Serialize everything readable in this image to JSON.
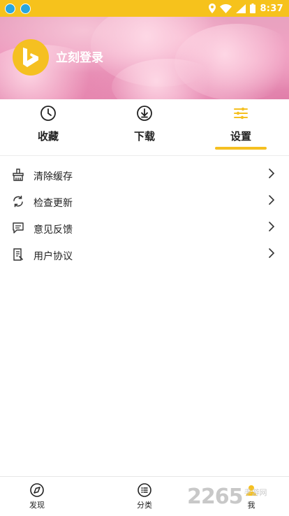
{
  "status_bar": {
    "time": "8:37"
  },
  "header": {
    "login_label": "立刻登录"
  },
  "tabs": [
    {
      "label": "收藏",
      "icon": "clock-icon"
    },
    {
      "label": "下载",
      "icon": "download-icon"
    },
    {
      "label": "设置",
      "icon": "settings-sliders-icon",
      "active": true
    }
  ],
  "menu": [
    {
      "label": "清除缓存",
      "icon": "broom-icon"
    },
    {
      "label": "检查更新",
      "icon": "refresh-icon"
    },
    {
      "label": "意见反馈",
      "icon": "feedback-icon"
    },
    {
      "label": "用户协议",
      "icon": "document-icon"
    }
  ],
  "bottom_nav": [
    {
      "label": "发现",
      "icon": "compass-icon"
    },
    {
      "label": "分类",
      "icon": "category-list-icon"
    },
    {
      "label": "我",
      "icon": "user-icon"
    }
  ],
  "watermark": {
    "number": "2265",
    "text": "手游网"
  },
  "colors": {
    "accent": "#f5c021",
    "status_bar": "#f6c21c",
    "text": "#222222"
  }
}
